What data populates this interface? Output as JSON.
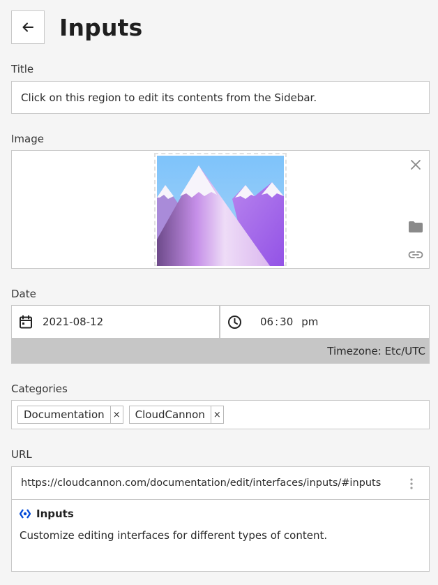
{
  "header": {
    "title": "Inputs",
    "back_icon": "arrow-left-icon"
  },
  "fields": {
    "title": {
      "label": "Title",
      "value": "Click on this region to edit its contents from the Sidebar."
    },
    "image": {
      "label": "Image",
      "tools": [
        "close-icon",
        "folder-icon",
        "link-icon"
      ]
    },
    "date": {
      "label": "Date",
      "date_value": "2021-08-12",
      "time_hour": "06",
      "time_minute": "30",
      "time_period": "pm",
      "timezone": "Timezone: Etc/UTC"
    },
    "categories": {
      "label": "Categories",
      "tags": [
        "Documentation",
        "CloudCannon"
      ],
      "remove_glyph": "×"
    },
    "url": {
      "label": "URL",
      "value": "https://cloudcannon.com/documentation/edit/interfaces/inputs/#inputs",
      "preview_title": "Inputs",
      "preview_description": "Customize editing interfaces for different types of content."
    }
  },
  "colors": {
    "accent": "#034ad8",
    "border": "#c8c8c8",
    "timezone_bar": "#c6c6c6"
  }
}
